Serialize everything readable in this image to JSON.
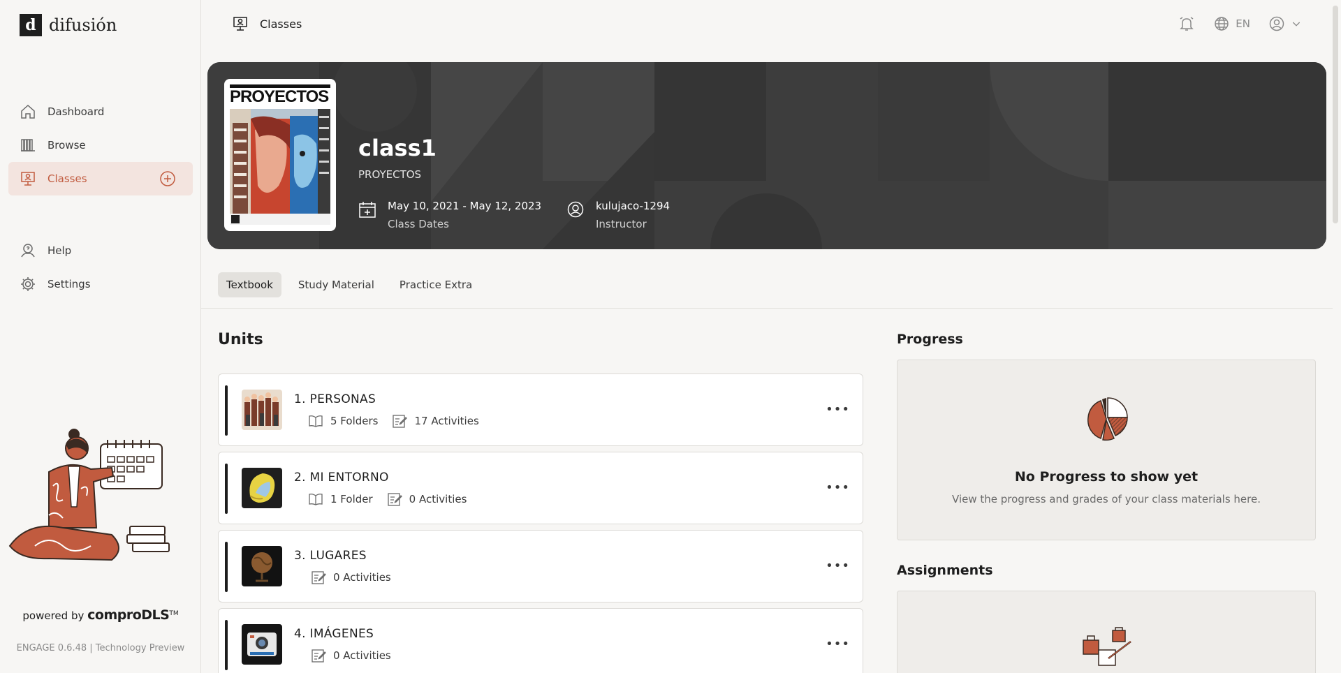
{
  "app": {
    "brand": "difusión",
    "brand_mark": "d",
    "powered_prefix": "powered by",
    "powered_brand": "comproDLS",
    "powered_tm": "TM",
    "version": "ENGAGE 0.6.48 | Technology Preview"
  },
  "sidebar": {
    "items": [
      {
        "label": "Dashboard",
        "icon": "home-icon"
      },
      {
        "label": "Browse",
        "icon": "books-icon"
      },
      {
        "label": "Classes",
        "icon": "classroom-icon",
        "active": true
      }
    ],
    "bottom_items": [
      {
        "label": "Help",
        "icon": "help-icon"
      },
      {
        "label": "Settings",
        "icon": "gear-icon"
      }
    ]
  },
  "topbar": {
    "breadcrumb": "Classes",
    "language": "EN"
  },
  "class": {
    "name": "class1",
    "book": "PROYECTOS",
    "cover_title": "PROYECTOS",
    "dates": "May 10, 2021 - May 12, 2023",
    "dates_label": "Class Dates",
    "instructor": "kulujaco-1294",
    "instructor_label": "Instructor"
  },
  "tabs": [
    {
      "label": "Textbook",
      "active": true
    },
    {
      "label": "Study Material"
    },
    {
      "label": "Practice Extra"
    }
  ],
  "units": {
    "heading": "Units",
    "items": [
      {
        "title": "1.  PERSONAS",
        "folders": "5 Folders",
        "activities": "17 Activities"
      },
      {
        "title": "2.  MI ENTORNO",
        "folders": "1 Folder",
        "activities": "0 Activities"
      },
      {
        "title": "3.  LUGARES",
        "folders": null,
        "activities": "0 Activities"
      },
      {
        "title": "4.  IMÁGENES",
        "folders": null,
        "activities": "0 Activities"
      }
    ]
  },
  "progress": {
    "heading": "Progress",
    "empty_title": "No Progress to show yet",
    "empty_sub": "View the progress and grades of your class materials here."
  },
  "assignments": {
    "heading": "Assignments"
  },
  "colors": {
    "accent": "#c15b3f",
    "active_bg": "#f3e4df",
    "banner": "#3d3d3d"
  }
}
